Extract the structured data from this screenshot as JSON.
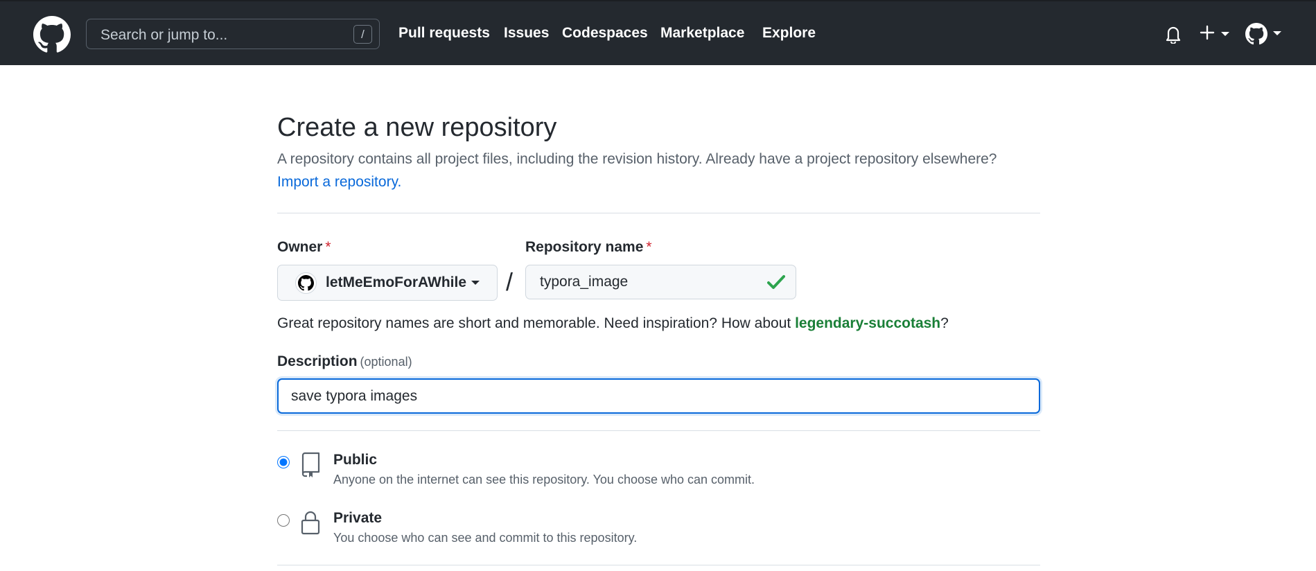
{
  "header": {
    "search_placeholder": "Search or jump to...",
    "search_shortcut": "/",
    "nav": [
      "Pull requests",
      "Issues",
      "Codespaces",
      "Marketplace",
      "Explore"
    ],
    "icons": [
      "github-logo-icon",
      "bell-icon",
      "plus-icon",
      "avatar"
    ]
  },
  "page": {
    "title": "Create a new repository",
    "lead": "A repository contains all project files, including the revision history. Already have a project repository elsewhere?",
    "import_link": "Import a repository."
  },
  "form": {
    "owner_label": "Owner",
    "required_mark": "*",
    "owner_value": "letMeEmoForAWhile",
    "separator": "/",
    "repo_label": "Repository name",
    "repo_value": "typora_image",
    "hint_prefix": "Great repository names are short and memorable. Need inspiration? How about ",
    "hint_suggestion": "legendary-succotash",
    "hint_suffix": "?",
    "description_label": "Description",
    "description_optional": "(optional)",
    "description_value": "save typora images"
  },
  "visibility": {
    "options": [
      {
        "title": "Public",
        "description": "Anyone on the internet can see this repository. You choose who can commit.",
        "selected": true,
        "icon": "repo-icon"
      },
      {
        "title": "Private",
        "description": "You choose who can see and commit to this repository.",
        "selected": false,
        "icon": "lock-icon"
      }
    ]
  },
  "colors": {
    "header_bg": "#24292f",
    "link": "#0969da",
    "success": "#1a7f37",
    "required": "#cf222e",
    "focus_border": "#0969da"
  }
}
